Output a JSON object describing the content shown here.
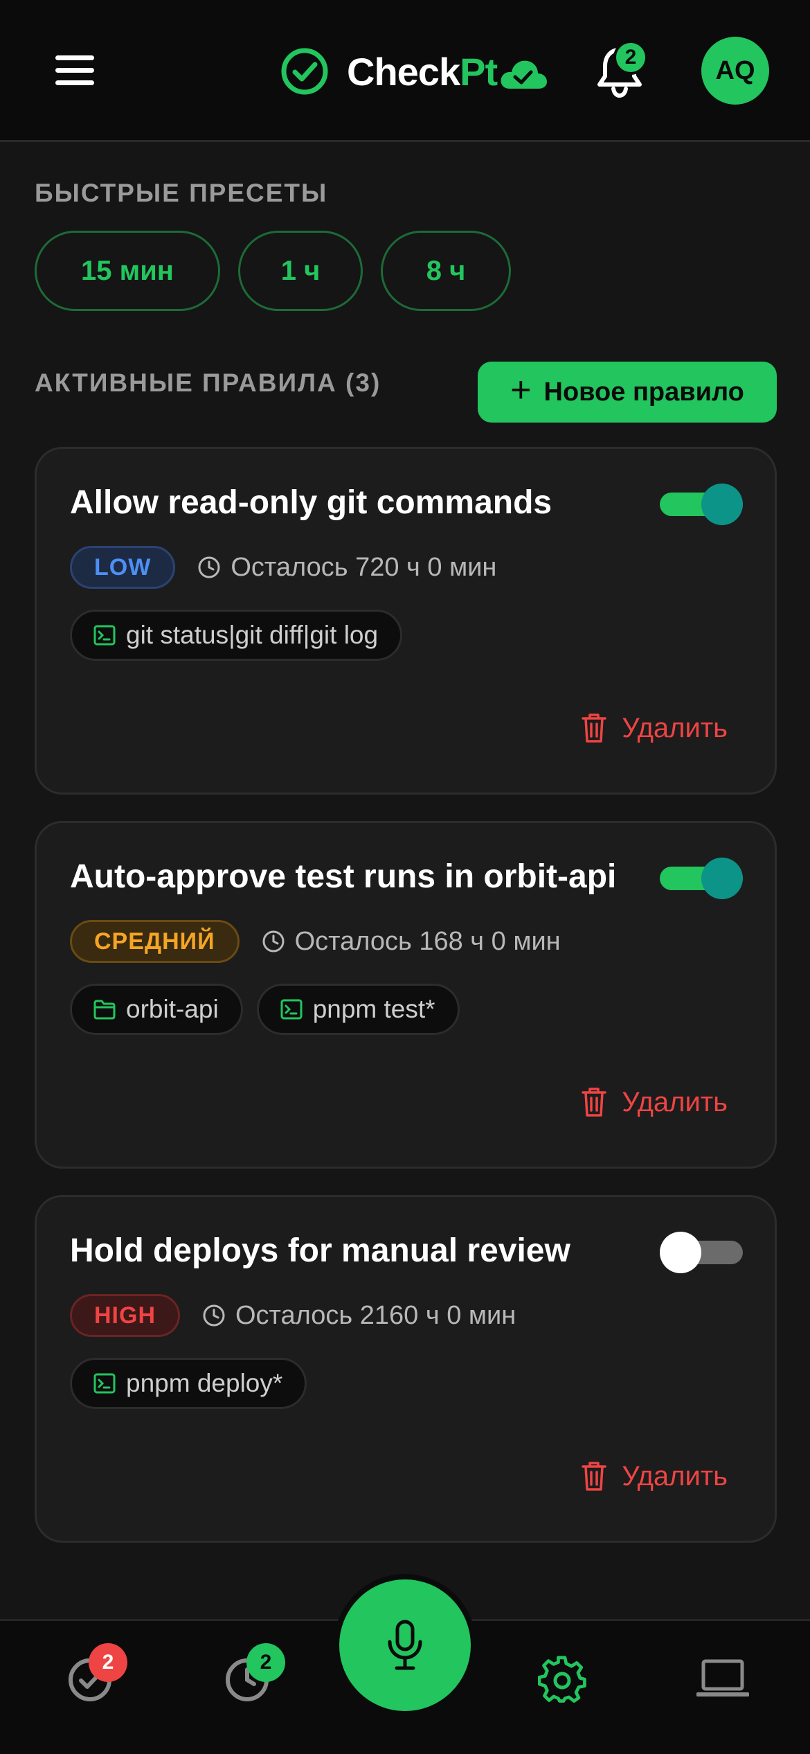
{
  "header": {
    "app_name_part1": "Check",
    "app_name_part2": "Pt",
    "notifications_count": "2",
    "avatar_initials": "AQ"
  },
  "presets": {
    "section_title": "БЫСТРЫЕ ПРЕСЕТЫ",
    "items": [
      {
        "label": "15 мин"
      },
      {
        "label": "1 ч"
      },
      {
        "label": "8 ч"
      }
    ]
  },
  "rules": {
    "section_title": "АКТИВНЫЕ ПРАВИЛА (3)",
    "new_rule_label": "Новое правило",
    "delete_label": "Удалить",
    "items": [
      {
        "title": "Allow read-only git commands",
        "enabled": true,
        "risk": "LOW",
        "remaining": "Осталось 720 ч 0 мин",
        "chips": [
          {
            "icon": "terminal-icon",
            "text": "git status|git diff|git log"
          }
        ]
      },
      {
        "title": "Auto-approve test runs in orbit-api",
        "enabled": true,
        "risk": "СРЕДНИЙ",
        "remaining": "Осталось 168 ч 0 мин",
        "chips": [
          {
            "icon": "folder-icon",
            "text": "orbit-api"
          },
          {
            "icon": "terminal-icon",
            "text": "pnpm test*"
          }
        ]
      },
      {
        "title": "Hold deploys for manual review",
        "enabled": false,
        "risk": "HIGH",
        "remaining": "Осталось 2160 ч 0 мин",
        "chips": [
          {
            "icon": "terminal-icon",
            "text": "pnpm deploy*"
          }
        ]
      }
    ]
  },
  "bottom_nav": {
    "approvals_badge": "2",
    "history_badge": "2"
  },
  "colors": {
    "accent": "#22c55e",
    "danger": "#ef4444",
    "warning": "#f5a524",
    "info": "#4d8ff5",
    "background": "#151515"
  }
}
